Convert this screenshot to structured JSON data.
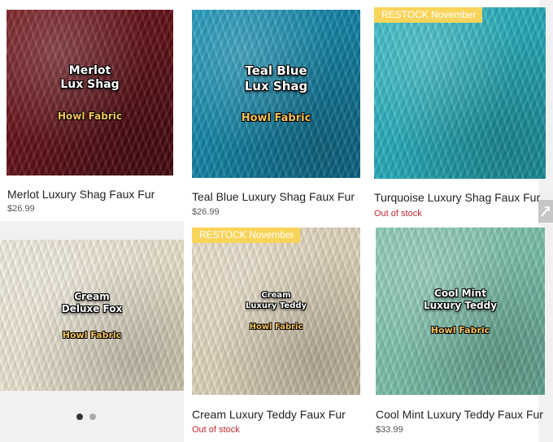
{
  "products": [
    {
      "title": "Merlot Luxury Shag Faux Fur",
      "status": "$26.99",
      "overlay": "Merlot\nLux Shag",
      "brand": "Howl Fabric",
      "colors": [
        "#7a1a20",
        "#4a0a10"
      ]
    },
    {
      "title": "Teal Blue Luxury Shag Faux Fur",
      "status": "$26.99",
      "overlay": "Teal Blue\nLux Shag",
      "brand": "Howl Fabric",
      "colors": [
        "#1a9bbf",
        "#0e6d8c"
      ]
    },
    {
      "title": "Turquoise Luxury Shag Faux Fur",
      "status": "Out of stock",
      "badge": "RESTOCK November",
      "colors": [
        "#33c0cc",
        "#1b9aa8"
      ]
    },
    {
      "overlay": "Cream\nDeluxe Fox",
      "brand": "Howl Fabric",
      "colors": [
        "#f6f1e2",
        "#e4dcc4"
      ]
    },
    {
      "title": "Cream Luxury Teddy Faux Fur",
      "status": "Out of stock",
      "badge": "RESTOCK November",
      "overlay": "Cream\nLuxury Teddy",
      "brand": "Howl Fabric",
      "colors": [
        "#efe4cf",
        "#d8cab0"
      ]
    },
    {
      "title": "Cool Mint Luxury Teddy Faux Fur",
      "status": "$33.99",
      "overlay": "Cool Mint\nLuxury Teddy",
      "brand": "Howl Fabric",
      "colors": [
        "#8fd0bb",
        "#6db5a0"
      ]
    }
  ],
  "carousel": {
    "active_color": "#333333",
    "inactive_color": "#aaaaaa"
  },
  "badge_color": "#f8d45a",
  "out_of_stock_color": "#c0272d",
  "expand_icon": "diagonal-arrow-icon"
}
